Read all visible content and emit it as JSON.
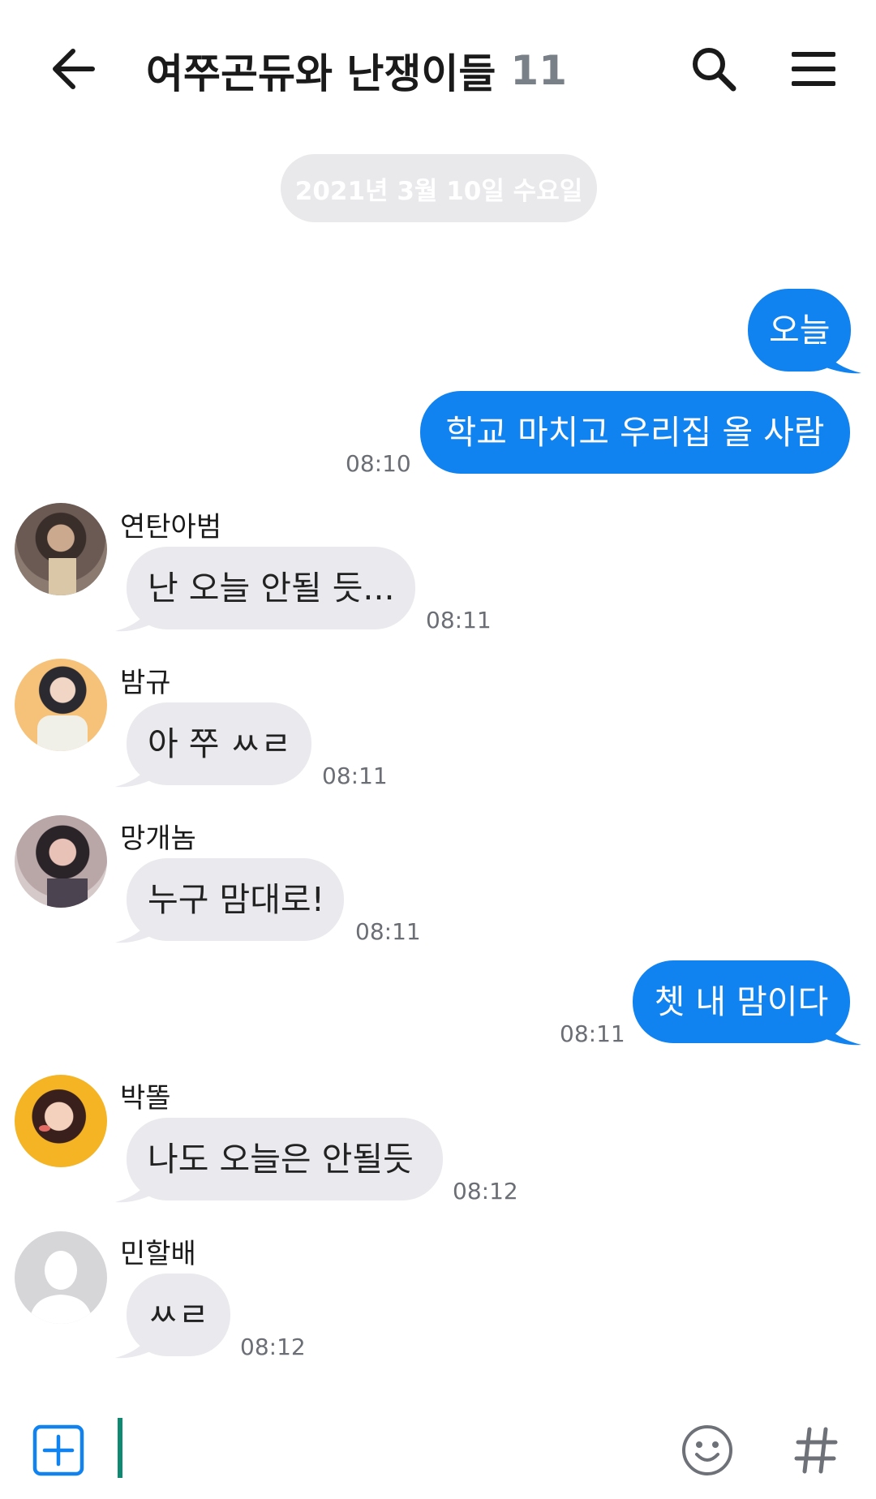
{
  "header": {
    "back_icon": "arrow-left-icon",
    "title": "여쭈곤듀와 난쟁이들",
    "member_count": "11",
    "search_icon": "search-icon",
    "menu_icon": "hamburger-menu-icon"
  },
  "date_divider": "2021년 3월 10일 수요일",
  "messages": [
    {
      "from": "me",
      "text": "오늘"
    },
    {
      "from": "me",
      "text": "학교 마치고 우리집 올 사람",
      "time": "08:10"
    },
    {
      "from": "연탄아범",
      "text": "난 오늘 안될 듯...",
      "time": "08:11"
    },
    {
      "from": "밤규",
      "text": "아 쭈 ㅆㄹ",
      "time": "08:11"
    },
    {
      "from": "망개놈",
      "text": "누구 맘대로!",
      "time": "08:11"
    },
    {
      "from": "me",
      "text": "쳇 내 맘이다",
      "time": "08:11"
    },
    {
      "from": "박똘",
      "text": "나도 오늘은 안될듯",
      "time": "08:12"
    },
    {
      "from": "민할배",
      "text": "ㅆㄹ",
      "time": "08:12"
    }
  ],
  "input": {
    "add_icon": "plus-square-icon",
    "emoji_icon": "smiley-icon",
    "hashtag_icon": "hashtag-icon"
  },
  "colors": {
    "accent": "#1183f0",
    "other_bubble": "#eaeaee",
    "caret": "#0f8a72"
  }
}
